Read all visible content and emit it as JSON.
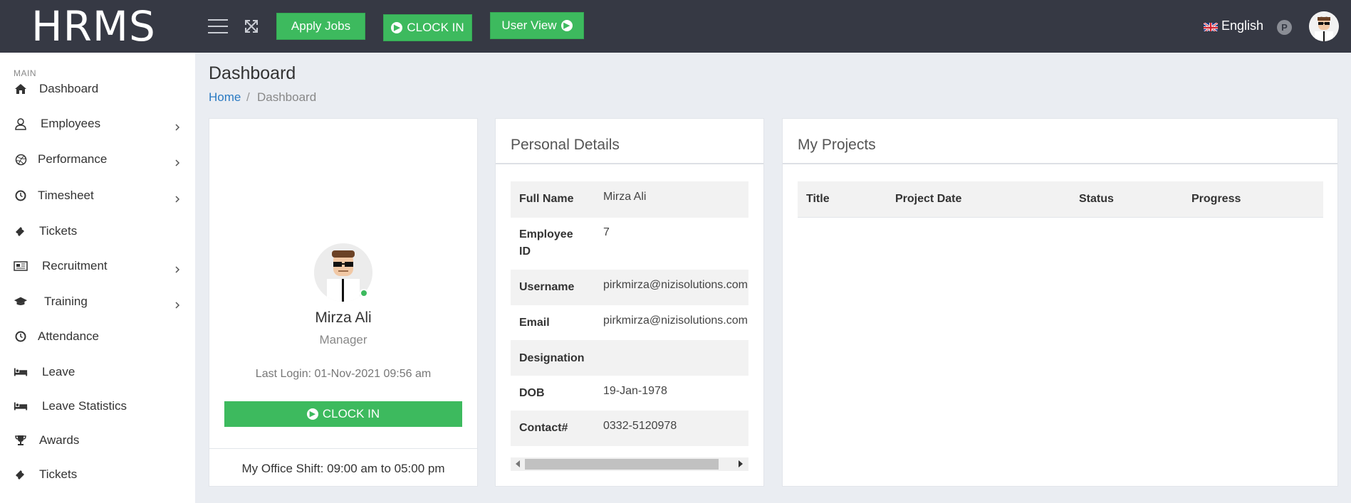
{
  "header": {
    "logo": "HRMS",
    "apply_jobs": "Apply Jobs",
    "clock_in": "CLOCK IN",
    "user_view": "User View",
    "language": "English",
    "badge": "P"
  },
  "sidebar": {
    "heading": "MAIN",
    "items": [
      {
        "label": "Dashboard",
        "icon": "home-icon",
        "has_submenu": false
      },
      {
        "label": "Employees",
        "icon": "user-icon",
        "has_submenu": true
      },
      {
        "label": "Performance",
        "icon": "dribbble-icon",
        "has_submenu": true
      },
      {
        "label": "Timesheet",
        "icon": "clock-icon",
        "has_submenu": true
      },
      {
        "label": "Tickets",
        "icon": "ticket-icon",
        "has_submenu": false
      },
      {
        "label": "Recruitment",
        "icon": "newspaper-icon",
        "has_submenu": true
      },
      {
        "label": "Training",
        "icon": "graduation-cap-icon",
        "has_submenu": true
      },
      {
        "label": "Attendance",
        "icon": "clock-icon",
        "has_submenu": false
      },
      {
        "label": "Leave",
        "icon": "bed-icon",
        "has_submenu": false
      },
      {
        "label": "Leave Statistics",
        "icon": "bed-icon",
        "has_submenu": false
      },
      {
        "label": "Awards",
        "icon": "trophy-icon",
        "has_submenu": false
      },
      {
        "label": "Tickets",
        "icon": "ticket-icon",
        "has_submenu": false
      }
    ]
  },
  "page": {
    "title": "Dashboard",
    "breadcrumb_home": "Home",
    "breadcrumb_sep": "/",
    "breadcrumb_current": "Dashboard"
  },
  "profile": {
    "name": "Mirza Ali",
    "role": "Manager",
    "last_login": "Last Login: 01-Nov-2021 09:56 am",
    "clock_in": "CLOCK IN",
    "shift": "My Office Shift: 09:00 am to 05:00 pm"
  },
  "personal_details": {
    "title": "Personal Details",
    "rows": [
      {
        "key": "Full Name",
        "value": "Mirza Ali"
      },
      {
        "key": "Employee ID",
        "value": "7"
      },
      {
        "key": "Username",
        "value": "pirkmirza@nizisolutions.com"
      },
      {
        "key": "Email",
        "value": "pirkmirza@nizisolutions.com"
      },
      {
        "key": "Designation",
        "value": ""
      },
      {
        "key": "DOB",
        "value": "19-Jan-1978"
      },
      {
        "key": "Contact#",
        "value": "0332-5120978"
      }
    ]
  },
  "projects": {
    "title": "My Projects",
    "columns": [
      "Title",
      "Project Date",
      "Status",
      "Progress"
    ]
  },
  "colors": {
    "topbar": "#363944",
    "accent_green": "#3dba5e",
    "link_blue": "#2a7ac2",
    "page_bg": "#eaedf2"
  }
}
